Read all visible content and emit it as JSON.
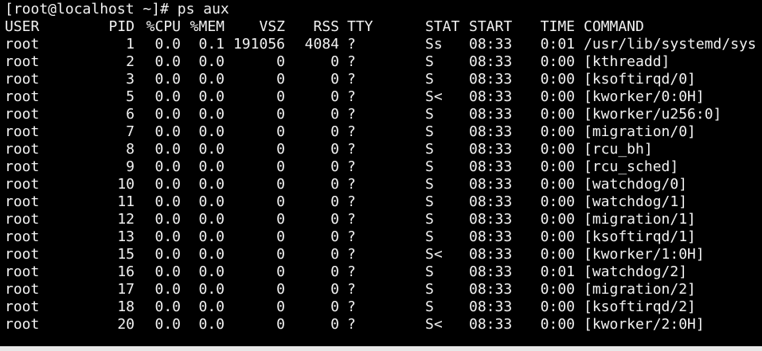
{
  "prompt": "[root@localhost ~]# ps aux",
  "headers": {
    "user": "USER",
    "pid": "PID",
    "cpu": "%CPU",
    "mem": "%MEM",
    "vsz": "VSZ",
    "rss": "RSS",
    "tty": "TTY",
    "stat": "STAT",
    "start": "START",
    "time": "TIME",
    "command": "COMMAND"
  },
  "rows": [
    {
      "user": "root",
      "pid": "1",
      "cpu": "0.0",
      "mem": "0.1",
      "vsz": "191056",
      "rss": "4084",
      "tty": "?",
      "stat": "Ss",
      "start": "08:33",
      "time": "0:01",
      "command": "/usr/lib/systemd/sys"
    },
    {
      "user": "root",
      "pid": "2",
      "cpu": "0.0",
      "mem": "0.0",
      "vsz": "0",
      "rss": "0",
      "tty": "?",
      "stat": "S",
      "start": "08:33",
      "time": "0:00",
      "command": "[kthreadd]"
    },
    {
      "user": "root",
      "pid": "3",
      "cpu": "0.0",
      "mem": "0.0",
      "vsz": "0",
      "rss": "0",
      "tty": "?",
      "stat": "S",
      "start": "08:33",
      "time": "0:00",
      "command": "[ksoftirqd/0]"
    },
    {
      "user": "root",
      "pid": "5",
      "cpu": "0.0",
      "mem": "0.0",
      "vsz": "0",
      "rss": "0",
      "tty": "?",
      "stat": "S<",
      "start": "08:33",
      "time": "0:00",
      "command": "[kworker/0:0H]"
    },
    {
      "user": "root",
      "pid": "6",
      "cpu": "0.0",
      "mem": "0.0",
      "vsz": "0",
      "rss": "0",
      "tty": "?",
      "stat": "S",
      "start": "08:33",
      "time": "0:00",
      "command": "[kworker/u256:0]"
    },
    {
      "user": "root",
      "pid": "7",
      "cpu": "0.0",
      "mem": "0.0",
      "vsz": "0",
      "rss": "0",
      "tty": "?",
      "stat": "S",
      "start": "08:33",
      "time": "0:00",
      "command": "[migration/0]"
    },
    {
      "user": "root",
      "pid": "8",
      "cpu": "0.0",
      "mem": "0.0",
      "vsz": "0",
      "rss": "0",
      "tty": "?",
      "stat": "S",
      "start": "08:33",
      "time": "0:00",
      "command": "[rcu_bh]"
    },
    {
      "user": "root",
      "pid": "9",
      "cpu": "0.0",
      "mem": "0.0",
      "vsz": "0",
      "rss": "0",
      "tty": "?",
      "stat": "S",
      "start": "08:33",
      "time": "0:00",
      "command": "[rcu_sched]"
    },
    {
      "user": "root",
      "pid": "10",
      "cpu": "0.0",
      "mem": "0.0",
      "vsz": "0",
      "rss": "0",
      "tty": "?",
      "stat": "S",
      "start": "08:33",
      "time": "0:00",
      "command": "[watchdog/0]"
    },
    {
      "user": "root",
      "pid": "11",
      "cpu": "0.0",
      "mem": "0.0",
      "vsz": "0",
      "rss": "0",
      "tty": "?",
      "stat": "S",
      "start": "08:33",
      "time": "0:00",
      "command": "[watchdog/1]"
    },
    {
      "user": "root",
      "pid": "12",
      "cpu": "0.0",
      "mem": "0.0",
      "vsz": "0",
      "rss": "0",
      "tty": "?",
      "stat": "S",
      "start": "08:33",
      "time": "0:00",
      "command": "[migration/1]"
    },
    {
      "user": "root",
      "pid": "13",
      "cpu": "0.0",
      "mem": "0.0",
      "vsz": "0",
      "rss": "0",
      "tty": "?",
      "stat": "S",
      "start": "08:33",
      "time": "0:00",
      "command": "[ksoftirqd/1]"
    },
    {
      "user": "root",
      "pid": "15",
      "cpu": "0.0",
      "mem": "0.0",
      "vsz": "0",
      "rss": "0",
      "tty": "?",
      "stat": "S<",
      "start": "08:33",
      "time": "0:00",
      "command": "[kworker/1:0H]"
    },
    {
      "user": "root",
      "pid": "16",
      "cpu": "0.0",
      "mem": "0.0",
      "vsz": "0",
      "rss": "0",
      "tty": "?",
      "stat": "S",
      "start": "08:33",
      "time": "0:01",
      "command": "[watchdog/2]"
    },
    {
      "user": "root",
      "pid": "17",
      "cpu": "0.0",
      "mem": "0.0",
      "vsz": "0",
      "rss": "0",
      "tty": "?",
      "stat": "S",
      "start": "08:33",
      "time": "0:00",
      "command": "[migration/2]"
    },
    {
      "user": "root",
      "pid": "18",
      "cpu": "0.0",
      "mem": "0.0",
      "vsz": "0",
      "rss": "0",
      "tty": "?",
      "stat": "S",
      "start": "08:33",
      "time": "0:00",
      "command": "[ksoftirqd/2]"
    },
    {
      "user": "root",
      "pid": "20",
      "cpu": "0.0",
      "mem": "0.0",
      "vsz": "0",
      "rss": "0",
      "tty": "?",
      "stat": "S<",
      "start": "08:33",
      "time": "0:00",
      "command": "[kworker/2:0H]"
    }
  ]
}
